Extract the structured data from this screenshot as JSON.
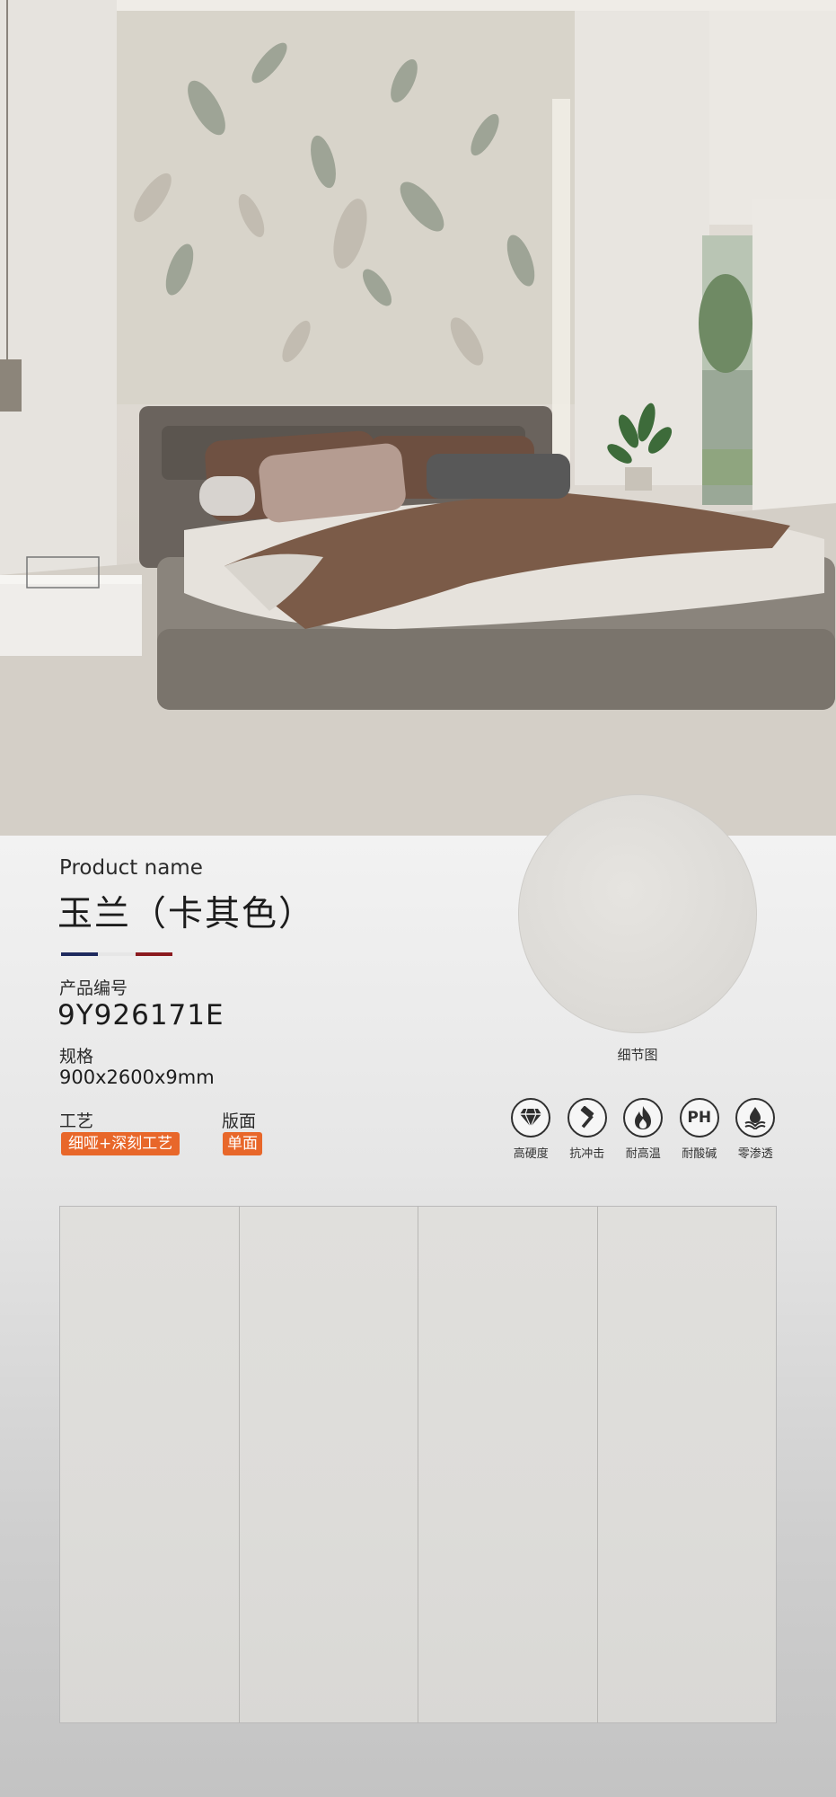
{
  "product": {
    "label_en": "Product name",
    "name": "玉兰（卡其色）",
    "code_label": "产品编号",
    "code": "9Y926171E",
    "spec_label": "规格",
    "spec": "900x2600x9mm",
    "craft_label": "工艺",
    "craft": "细哑+深刻工艺",
    "face_label": "版面",
    "face": "单面"
  },
  "detail": {
    "caption": "细节图"
  },
  "features": [
    {
      "icon": "diamond-icon",
      "label": "高硬度"
    },
    {
      "icon": "hammer-icon",
      "label": "抗冲击"
    },
    {
      "icon": "flame-icon",
      "label": "耐高温"
    },
    {
      "icon": "ph-icon",
      "label": "耐酸碱",
      "symbol": "PH"
    },
    {
      "icon": "droplet-icon",
      "label": "零渗透"
    }
  ],
  "colors": {
    "accent": "#e8672a",
    "flag": [
      "#1f2a5e",
      "#e6e6e6",
      "#8b1a1f"
    ]
  },
  "tiles": {
    "count": 4
  }
}
